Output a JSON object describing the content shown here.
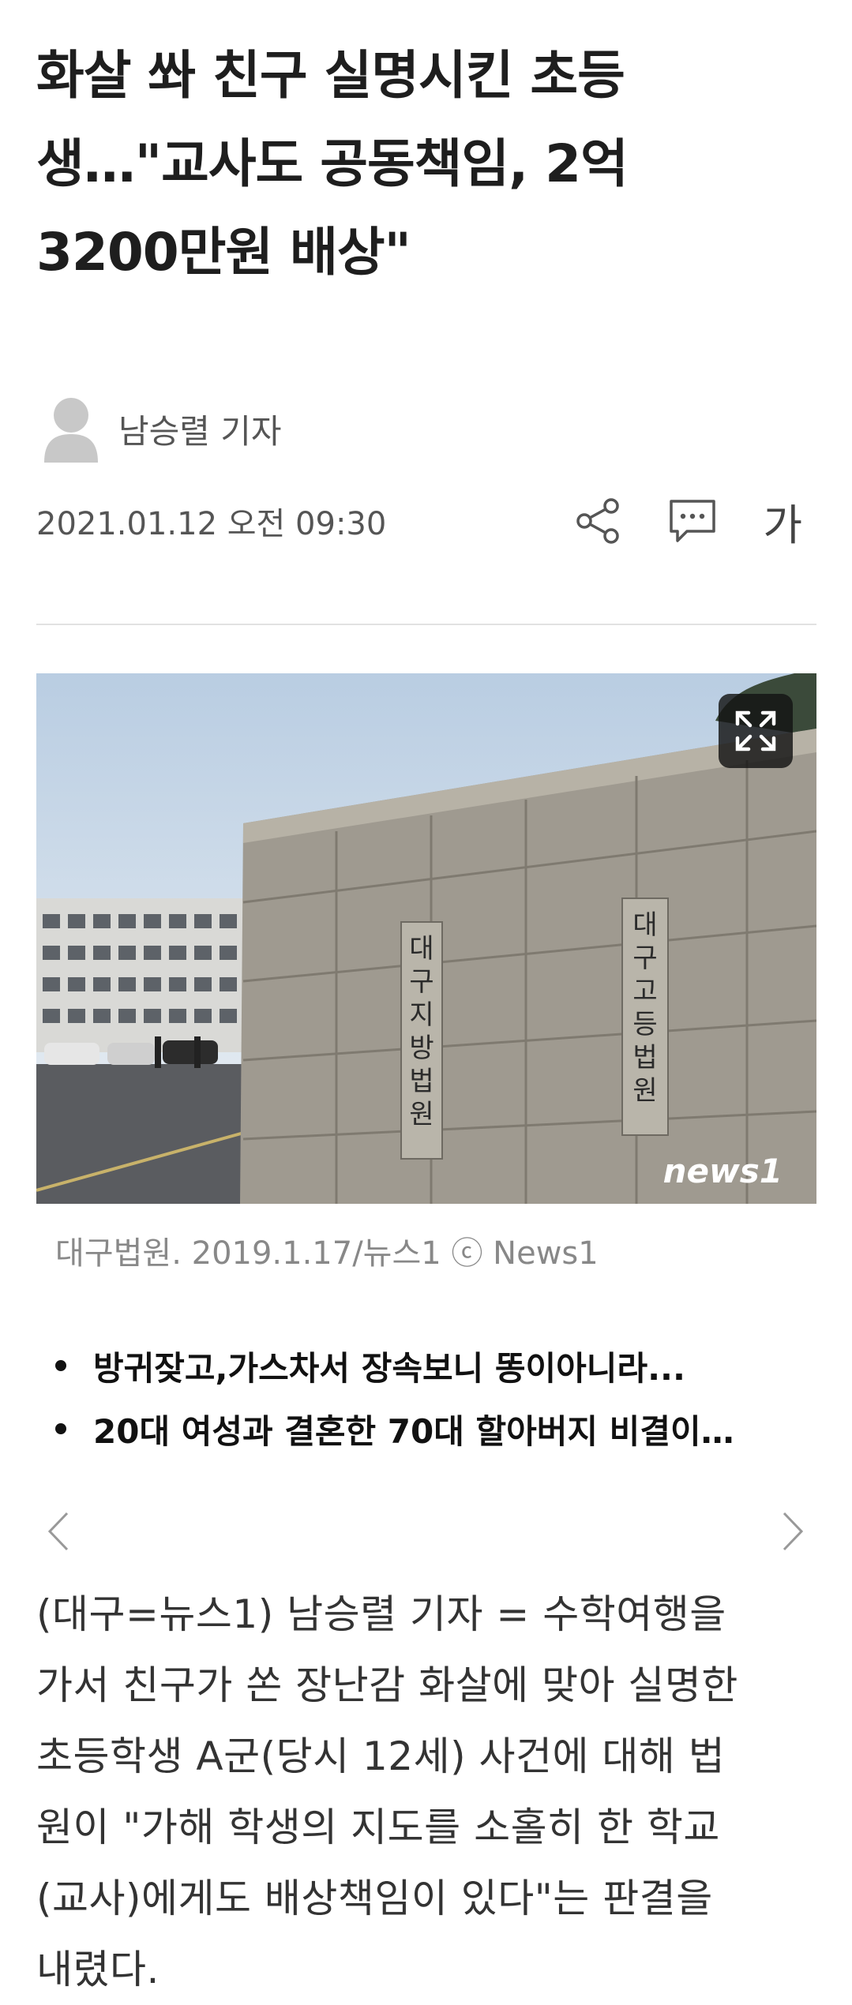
{
  "article": {
    "headline_lines": [
      "화살 쏴 친구 실명시킨 초등",
      "생…\"교사도 공동책임, 2억",
      "3200만원 배상\""
    ],
    "author": "남승렬 기자",
    "date": "2021.01.12 오전 09:30",
    "font_size_button": "가",
    "photo": {
      "signs": [
        "대구지방법원",
        "대구고등법원"
      ],
      "watermark": "news1",
      "caption": "대구법원. 2019.1.17/뉴스1 ⓒ News1"
    },
    "related": [
      "방귀잦고,가스차서 장속보니 똥이아니라...",
      "20대 여성과 결혼한 70대 할아버지 비결이…"
    ],
    "body_lines": [
      "(대구=뉴스1) 남승렬 기자 = 수학여행을",
      "가서 친구가 쏜 장난감 화살에 맞아 실명한",
      "초등학생 A군(당시 12세) 사건에 대해 법",
      "원이 \"가해 학생의 지도를 소홀히 한 학교",
      "(교사)에게도 배상책임이 있다\"는 판결을",
      "내렸다."
    ]
  },
  "icons": {
    "avatar": "person-silhouette-icon",
    "share": "share-icon",
    "comment": "comment-icon",
    "expand": "expand-icon",
    "prev": "chevron-left-icon",
    "next": "chevron-right-icon"
  },
  "colors": {
    "text": "#1e1e1e",
    "secondary": "#555555",
    "caption": "#888888",
    "divider": "#e2e2e2"
  }
}
